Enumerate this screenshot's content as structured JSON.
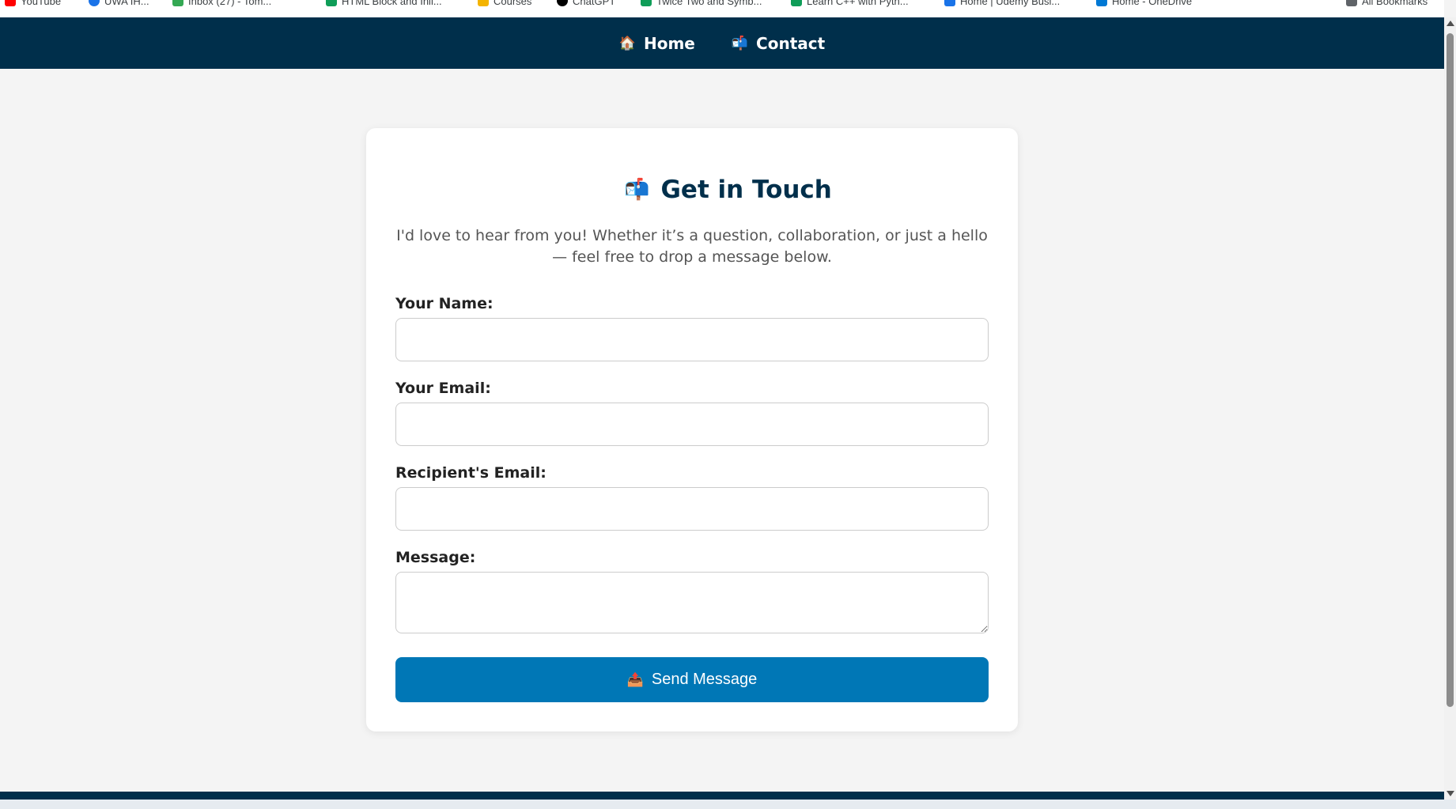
{
  "bookmarks": [
    {
      "label": "YouTube",
      "icon": "youtube-icon",
      "color": "#ff0000"
    },
    {
      "label": "UWA IH...",
      "icon": "bookmark-icon",
      "color": "#1a73e8"
    },
    {
      "label": "Inbox (27) - Tom...",
      "icon": "mail-icon",
      "color": "#34a853"
    },
    {
      "label": "HTML Block and Inli...",
      "icon": "bookmark-icon",
      "color": "#0f9d58"
    },
    {
      "label": "Courses",
      "icon": "bookmark-icon",
      "color": "#f4b400"
    },
    {
      "label": "ChatGPT",
      "icon": "chatgpt-icon",
      "color": "#000000"
    },
    {
      "label": "Twice Two and Symb...",
      "icon": "bookmark-icon",
      "color": "#0f9d58"
    },
    {
      "label": "Learn C++ with Pyth...",
      "icon": "bookmark-icon",
      "color": "#0f9d58"
    },
    {
      "label": "Home | Udemy Busi...",
      "icon": "bookmark-icon",
      "color": "#1a73e8"
    },
    {
      "label": "Home - OneDrive",
      "icon": "onedrive-icon",
      "color": "#0078d4"
    },
    {
      "label": "All Bookmarks",
      "icon": "folder-icon",
      "color": "#5f6368"
    }
  ],
  "nav": {
    "home_icon": "🏠",
    "home_label": "Home",
    "contact_icon": "📬",
    "contact_label": "Contact"
  },
  "contact": {
    "title_icon": "📬",
    "title": "Get in Touch",
    "intro": "I'd love to hear from you! Whether it’s a question, collaboration, or just a hello — feel free to drop a message below.",
    "name_label": "Your Name:",
    "name_value": "",
    "email_label": "Your Email:",
    "email_value": "",
    "recipient_label": "Recipient's Email:",
    "recipient_value": "",
    "message_label": "Message:",
    "message_value": "",
    "send_icon": "📤",
    "send_label": "Send Message"
  },
  "colors": {
    "navbar": "#002f4b",
    "accent": "#0077b6",
    "background": "#f4f4f4"
  }
}
